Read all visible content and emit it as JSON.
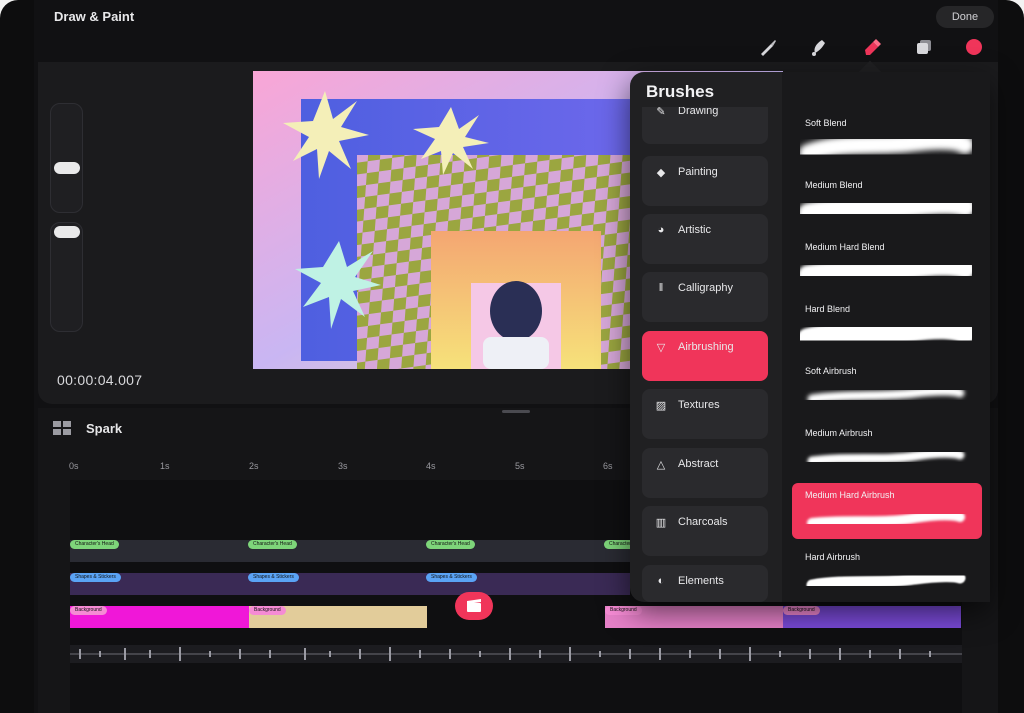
{
  "app": {
    "title": "Draw & Paint",
    "done_label": "Done"
  },
  "toolbar": {
    "tools": [
      "brush-icon",
      "smudge-icon",
      "eraser-icon",
      "layers-icon",
      "color-picker"
    ],
    "active_tool": "eraser-icon",
    "color": "#f0355a"
  },
  "canvas": {
    "timecode": "00:00:04.007"
  },
  "timeline": {
    "project_name": "Spark",
    "ruler": [
      "0s",
      "1s",
      "2s",
      "3s",
      "4s",
      "5s",
      "6s"
    ],
    "clips": {
      "characters": [
        "Character's Head",
        "Character's Head",
        "Character's Head",
        "Character's Head"
      ],
      "shapes": [
        "Shapes & Stickers",
        "Shapes & Stickers",
        "Shapes & Stickers"
      ],
      "backgrounds": [
        "Background",
        "Background",
        "Background",
        "Background"
      ]
    }
  },
  "brushes": {
    "title": "Brushes",
    "categories": [
      {
        "label": "Drawing",
        "icon": "pencil-icon"
      },
      {
        "label": "Painting",
        "icon": "paint-icon"
      },
      {
        "label": "Artistic",
        "icon": "palette-icon"
      },
      {
        "label": "Calligraphy",
        "icon": "calligraphy-icon"
      },
      {
        "label": "Airbrushing",
        "icon": "airbrush-icon"
      },
      {
        "label": "Textures",
        "icon": "texture-icon"
      },
      {
        "label": "Abstract",
        "icon": "triangle-icon"
      },
      {
        "label": "Charcoals",
        "icon": "charcoal-icon"
      },
      {
        "label": "Elements",
        "icon": "elements-icon"
      }
    ],
    "selected_category": "Airbrushing",
    "items": [
      {
        "name": "Soft Blend"
      },
      {
        "name": "Medium Blend"
      },
      {
        "name": "Medium Hard Blend"
      },
      {
        "name": "Hard Blend"
      },
      {
        "name": "Soft Airbrush"
      },
      {
        "name": "Medium Airbrush"
      },
      {
        "name": "Medium Hard Airbrush"
      },
      {
        "name": "Hard Airbrush"
      }
    ],
    "selected_brush": "Medium Hard Airbrush"
  },
  "colors": {
    "accent": "#f0355a",
    "panel": "#202022",
    "background": "#111113"
  }
}
